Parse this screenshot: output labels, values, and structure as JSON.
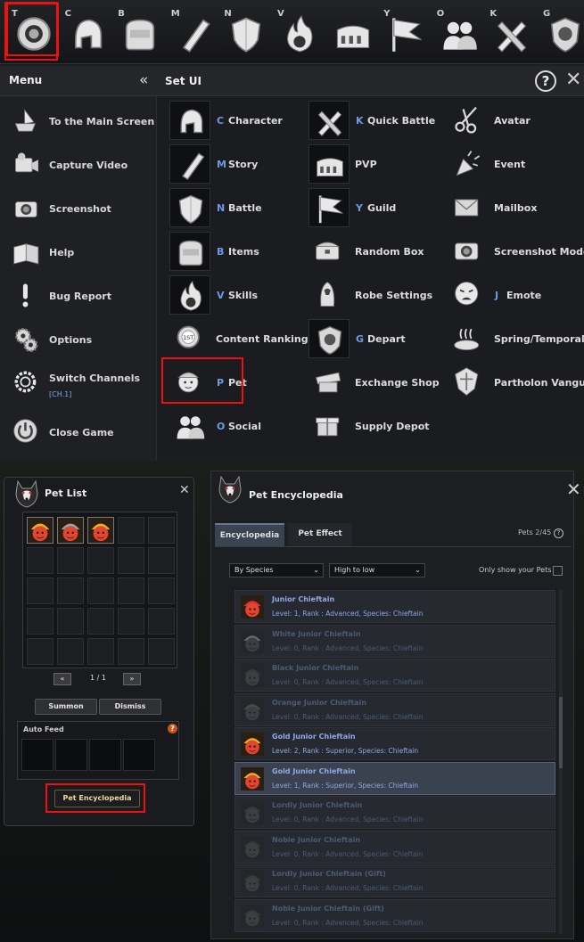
{
  "hotbar": [
    {
      "key": "T",
      "icon": "settings-gear-icon",
      "selected": true
    },
    {
      "key": "C",
      "icon": "helmet-icon",
      "selected": false
    },
    {
      "key": "B",
      "icon": "bag-icon",
      "selected": false
    },
    {
      "key": "M",
      "icon": "scroll-icon",
      "selected": false
    },
    {
      "key": "N",
      "icon": "shield-icon",
      "selected": false
    },
    {
      "key": "V",
      "icon": "fire-skill-icon",
      "selected": false
    },
    {
      "key": "",
      "icon": "colosseum-icon",
      "selected": false
    },
    {
      "key": "Y",
      "icon": "flag-icon",
      "selected": false
    },
    {
      "key": "O",
      "icon": "social-icon",
      "selected": false
    },
    {
      "key": "K",
      "icon": "quick-battle-icon",
      "selected": false
    },
    {
      "key": "G",
      "icon": "depart-emblem-icon",
      "selected": false
    }
  ],
  "menu": {
    "title": "Menu",
    "collapse": "«",
    "items": [
      {
        "label": "To the Main Screen",
        "icon": "ship-icon"
      },
      {
        "label": "Capture Video",
        "icon": "video-camera-icon"
      },
      {
        "label": "Screenshot",
        "icon": "camera-icon"
      },
      {
        "label": "Help",
        "icon": "book-icon"
      },
      {
        "label": "Bug Report",
        "icon": "exclamation-icon"
      },
      {
        "label": "Options",
        "icon": "gears-icon"
      },
      {
        "label": "Switch Channels",
        "sub": "[CH.1]",
        "icon": "channel-gear-icon"
      },
      {
        "label": "Close Game",
        "icon": "power-icon"
      }
    ]
  },
  "setui": {
    "title": "Set UI",
    "help": "?",
    "close": "✕",
    "columns": [
      [
        {
          "key": "C",
          "label": "Character",
          "icon": "helmet-icon",
          "dark": true
        },
        {
          "key": "M",
          "label": "Story",
          "icon": "scroll-icon",
          "dark": true
        },
        {
          "key": "N",
          "label": "Battle",
          "icon": "shield-icon",
          "dark": true
        },
        {
          "key": "B",
          "label": "Items",
          "icon": "bag-icon",
          "dark": true
        },
        {
          "key": "V",
          "label": "Skills",
          "icon": "fire-skill-icon",
          "dark": true
        },
        {
          "key": "",
          "label": "Content Ranking",
          "icon": "ranking-medal-icon",
          "dark": false
        },
        {
          "key": "P",
          "label": "Pet",
          "icon": "pet-icon",
          "dark": false
        },
        {
          "key": "O",
          "label": "Social",
          "icon": "social-icon",
          "dark": false
        }
      ],
      [
        {
          "key": "K",
          "label": "Quick Battle",
          "icon": "quick-battle-icon",
          "dark": true
        },
        {
          "key": "",
          "label": "PVP",
          "icon": "colosseum-icon",
          "dark": true
        },
        {
          "key": "Y",
          "label": "Guild",
          "icon": "flag-icon",
          "dark": true
        },
        {
          "key": "",
          "label": "Random Box",
          "icon": "chest-icon",
          "dark": false
        },
        {
          "key": "",
          "label": "Robe Settings",
          "icon": "robe-icon",
          "dark": false
        },
        {
          "key": "G",
          "label": "Depart",
          "icon": "depart-emblem-icon",
          "dark": true
        },
        {
          "key": "",
          "label": "Exchange Shop",
          "icon": "shop-icon",
          "dark": false
        },
        {
          "key": "",
          "label": "Supply Depot",
          "icon": "gift-icon",
          "dark": false
        }
      ],
      [
        {
          "key": "",
          "label": "Avatar",
          "icon": "scissors-icon",
          "dark": false
        },
        {
          "key": "",
          "label": "Event",
          "icon": "party-popper-icon",
          "dark": false
        },
        {
          "key": "",
          "label": "Mailbox",
          "icon": "envelope-icon",
          "dark": false
        },
        {
          "key": "",
          "label": "Screenshot Mode",
          "icon": "camera-icon",
          "dark": false
        },
        {
          "key": "J",
          "label": "Emote",
          "icon": "emote-face-icon",
          "dark": false
        },
        {
          "key": "",
          "label": "Spring/Temporal",
          "icon": "hot-spring-icon",
          "dark": false
        },
        {
          "key": "",
          "label": "Partholon Vangu",
          "icon": "vanguard-emblem-icon",
          "dark": false
        }
      ]
    ]
  },
  "petlist": {
    "title": "Pet List",
    "close": "✕",
    "pets": [
      "gold",
      "silver",
      "gold"
    ],
    "page": "1 / 1",
    "prev": "«",
    "next": "»",
    "summon": "Summon",
    "dismiss": "Dismiss",
    "autofeed": "Auto Feed",
    "encyclopedia_button": "Pet Encyclopedia"
  },
  "encyclopedia": {
    "title": "Pet Encyclopedia",
    "close": "✕",
    "tabs": [
      "Encyclopedia",
      "Pet Effect"
    ],
    "count": "Pets 2/45",
    "sort1": "By Species",
    "sort2": "High to low",
    "only_show": "Only show your Pets",
    "rows": [
      {
        "name": "Junior Chieftain",
        "info": "Level: 1,  Rank : Advanced,  Species: Chieftain",
        "owned": true,
        "color": "red",
        "selected": false
      },
      {
        "name": "White Junior Chieftain",
        "info": "Level: 0,  Rank : Advanced,  Species: Chieftain",
        "owned": false,
        "color": "white",
        "selected": false
      },
      {
        "name": "Black Junior Chieftain",
        "info": "Level: 0,  Rank : Advanced,  Species: Chieftain",
        "owned": false,
        "color": "black",
        "selected": false
      },
      {
        "name": "Orange Junior Chieftain",
        "info": "Level: 0,  Rank : Advanced,  Species: Chieftain",
        "owned": false,
        "color": "orange",
        "selected": false
      },
      {
        "name": "Gold Junior Chieftain",
        "info": "Level: 2,  Rank : Superior,  Species: Chieftain",
        "owned": true,
        "color": "gold",
        "selected": false
      },
      {
        "name": "Gold Junior Chieftain",
        "info": "Level: 1,  Rank : Superior,  Species: Chieftain",
        "owned": true,
        "color": "gold",
        "selected": true
      },
      {
        "name": "Lordly Junior Chieftain",
        "info": "Level: 0,  Rank : Advanced,  Species: Chieftain",
        "owned": false,
        "color": "red",
        "selected": false
      },
      {
        "name": "Noble Junior Chieftain",
        "info": "Level: 0,  Rank : Advanced,  Species: Chieftain",
        "owned": false,
        "color": "red",
        "selected": false
      },
      {
        "name": "Lordly Junior Chieftain (Gift)",
        "info": "Level: 0,  Rank : Advanced,  Species: Chieftain",
        "owned": false,
        "color": "red",
        "selected": false
      },
      {
        "name": "Noble Junior Chieftain (Gift)",
        "info": "Level: 0,  Rank : Advanced,  Species: Chieftain",
        "owned": false,
        "color": "red",
        "selected": false
      }
    ]
  },
  "colors": {
    "highlight": "#ee1111",
    "keyBlue": "#6d9ae6",
    "petText": "#8fa8e6"
  }
}
